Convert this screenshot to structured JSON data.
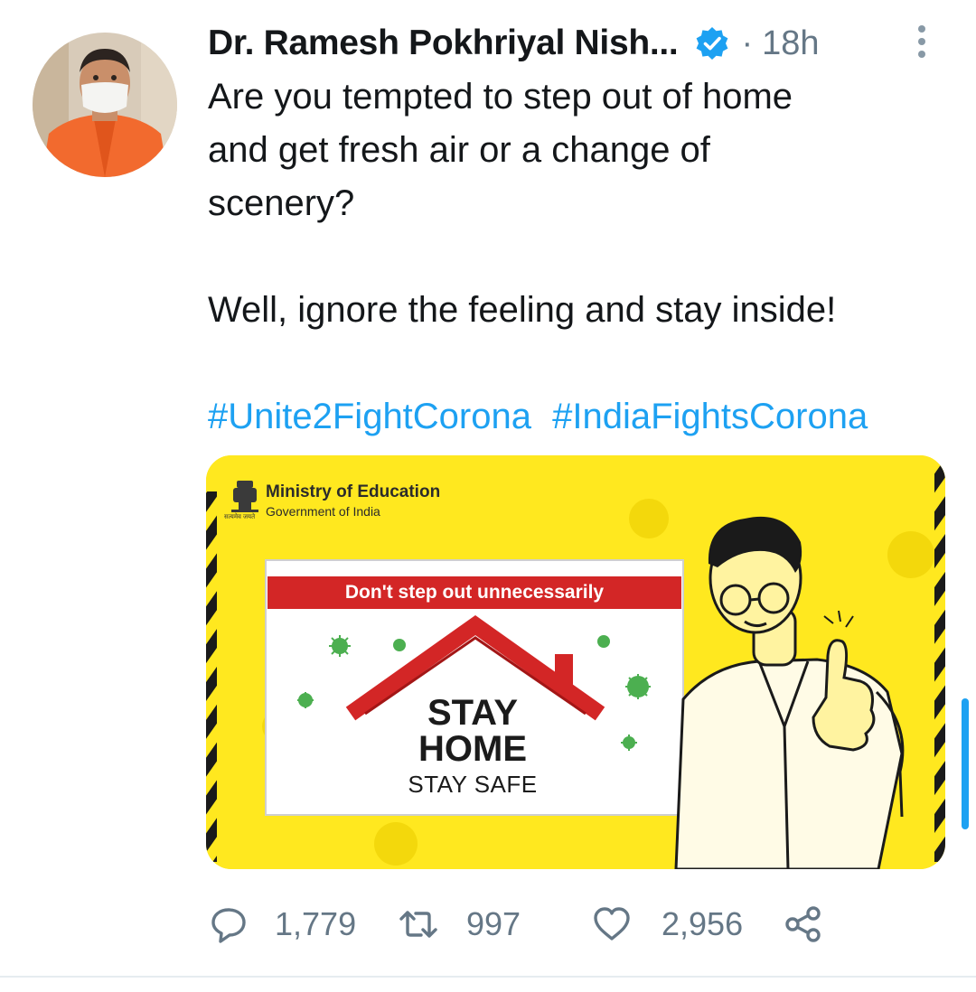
{
  "tweet": {
    "author_name": "Dr. Ramesh Pokhriyal Nish...",
    "separator": "·",
    "timestamp": "18h",
    "text_lines_1": [
      "Are you tempted to step out of home",
      "and get fresh air or a change of",
      "scenery?"
    ],
    "text_line_2": "Well, ignore the feeling and stay inside!",
    "hashtags": [
      "#Unite2FightCorona",
      "#IndiaFightsCorona"
    ]
  },
  "media": {
    "ministry": "Ministry of Education",
    "government": "Government of India",
    "emblem_caption": "सत्यमेव जयते",
    "banner": "Don't step out unnecessarily",
    "stay": "STAY",
    "home": "HOME",
    "stay_safe": "STAY  SAFE"
  },
  "actions": {
    "replies": "1,779",
    "retweets": "997",
    "likes": "2,956"
  },
  "icons": {
    "verified": "verified-badge-icon",
    "more": "more-vertical-icon",
    "reply": "reply-icon",
    "retweet": "retweet-icon",
    "like": "heart-icon",
    "share": "share-icon"
  },
  "colors": {
    "accent": "#1da1f2",
    "muted": "#657786",
    "poster_yellow": "#ffe81f",
    "banner_red": "#d32626"
  }
}
